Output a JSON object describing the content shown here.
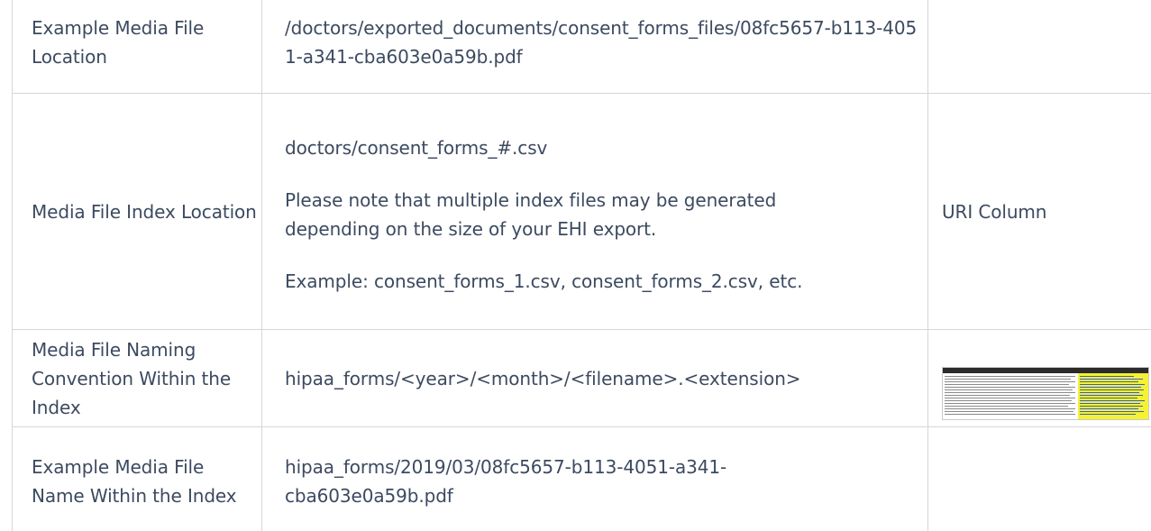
{
  "rows": [
    {
      "label": "Example Media File Location",
      "value_paragraphs": [
        "/doctors/exported_documents/consent_forms_files/08fc5657-b113-4051-a341-cba603e0a59b.pdf"
      ],
      "extra": ""
    },
    {
      "label": "Media File Index Location",
      "value_paragraphs": [
        "doctors/consent_forms_#.csv",
        "Please note that multiple index files may be generated depending on the size of your EHI export.",
        "Example: consent_forms_1.csv, consent_forms_2.csv, etc."
      ],
      "extra": "URI Column"
    },
    {
      "label": "Media File Naming Convention Within the Index",
      "value_paragraphs": [
        "hipaa_forms/<year>/<month>/<filename>.<extension>"
      ],
      "extra": "",
      "extra_image": "spreadsheet-screenshot-icon"
    },
    {
      "label": "Example Media File Name Within the Index",
      "value_paragraphs": [
        "hipaa_forms/2019/03/08fc5657-b113-4051-a341-cba603e0a59b.pdf"
      ],
      "extra": ""
    }
  ],
  "colors": {
    "text": "#3c4a60",
    "border": "#d6d6d6",
    "highlight": "#f5f233"
  }
}
